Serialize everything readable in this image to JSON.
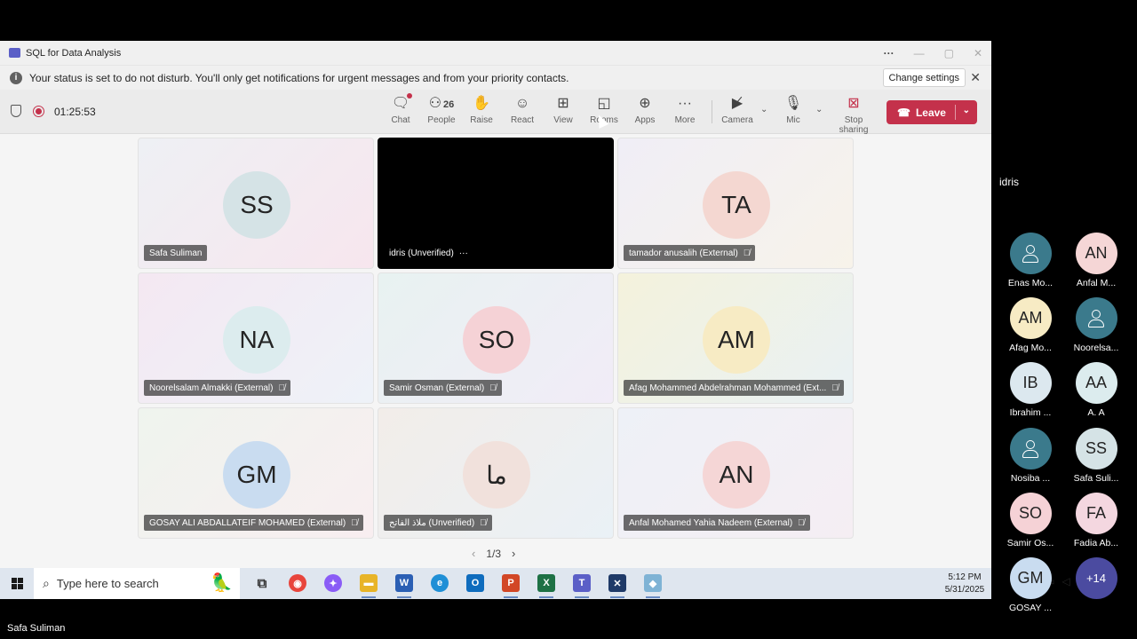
{
  "window": {
    "title": "SQL for Data Analysis"
  },
  "banner": {
    "message": "Your status is set to do not disturb. You'll only get notifications for urgent messages and from your priority contacts.",
    "change_button": "Change settings"
  },
  "toolbar": {
    "timer": "01:25:53",
    "chat_label": "Chat",
    "people_count": "26",
    "people_label": "People",
    "raise_label": "Raise",
    "react_label": "React",
    "view_label": "View",
    "rooms_label": "Rooms",
    "apps_label": "Apps",
    "more_label": "More",
    "camera_label": "Camera",
    "mic_label": "Mic",
    "stop_sharing_label": "Stop sharing",
    "leave_label": "Leave"
  },
  "tiles": [
    {
      "initials": "SS",
      "name": "Safa Suliman",
      "avatar_color": "#d5e3e6"
    },
    {
      "initials": "",
      "name": "idris (Unverified)",
      "video": true
    },
    {
      "initials": "TA",
      "name": "tamador anusalih (External)",
      "avatar_color": "#f4d7d1"
    },
    {
      "initials": "NA",
      "name": "Noorelsalam Almakki (External)",
      "avatar_color": "#dcecee"
    },
    {
      "initials": "SO",
      "name": "Samir Osman (External)",
      "avatar_color": "#f5d2d6"
    },
    {
      "initials": "AM",
      "name": "Afag Mohammed Abdelrahman Mohammed (Ext...",
      "avatar_color": "#f7ebc4"
    },
    {
      "initials": "GM",
      "name": "GOSAY ALI ABDALLATEIF MOHAMED (External)",
      "avatar_color": "#c9dcf0"
    },
    {
      "initials": "ما",
      "name": "ملاذ الفاتح (Unverified)",
      "avatar_color": "#f1e1dc"
    },
    {
      "initials": "AN",
      "name": "Anfal Mohamed Yahia Nadeem (External)",
      "avatar_color": "#f5d6d6"
    }
  ],
  "pager": {
    "text": "1/3"
  },
  "taskbar": {
    "search_placeholder": "Type here to search",
    "time": "5:12 PM",
    "date": "5/31/2025"
  },
  "side_panel": {
    "label": "idris",
    "people": [
      {
        "initials": "",
        "name": "Enas Mo...",
        "generic": true
      },
      {
        "initials": "AN",
        "name": "Anfal M...",
        "color": "#f5d6d6"
      },
      {
        "initials": "AM",
        "name": "Afag Mo...",
        "color": "#f7ebc4"
      },
      {
        "initials": "",
        "name": "Noorelsa...",
        "generic": true
      },
      {
        "initials": "IB",
        "name": "Ibrahim ...",
        "color": "#dce8ef"
      },
      {
        "initials": "AA",
        "name": "A. A",
        "color": "#dcecee"
      },
      {
        "initials": "",
        "name": "Nosiba ...",
        "generic": true
      },
      {
        "initials": "SS",
        "name": "Safa Suli...",
        "color": "#d5e3e6"
      },
      {
        "initials": "SO",
        "name": "Samir Os...",
        "color": "#f5d2d6"
      },
      {
        "initials": "FA",
        "name": "Fadia Ab...",
        "color": "#f4d7e0"
      },
      {
        "initials": "GM",
        "name": "GOSAY ...",
        "color": "#c9dcf0"
      },
      {
        "initials": "+14",
        "name": "",
        "more": true
      }
    ]
  },
  "presenter_name": "Safa Suliman"
}
